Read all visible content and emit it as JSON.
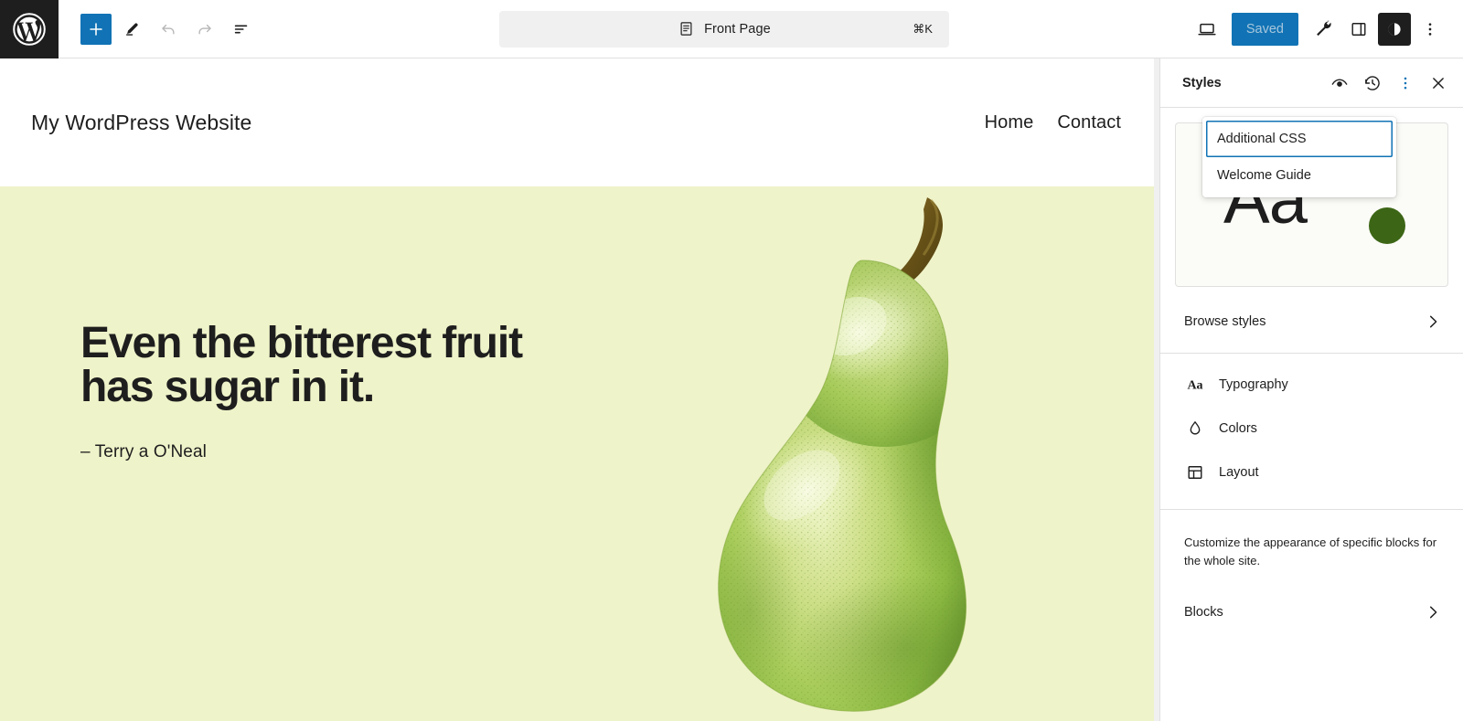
{
  "toolbar": {
    "logo_icon": "wordpress-logo-icon",
    "left_buttons": [
      {
        "name": "add-block-button",
        "label": "Add block",
        "icon": "plus-icon",
        "state": "primary"
      },
      {
        "name": "edit-mode-button",
        "label": "Edit",
        "icon": "pencil-icon",
        "state": "normal"
      },
      {
        "name": "undo-button",
        "label": "Undo",
        "icon": "undo-arrow-icon",
        "state": "disabled"
      },
      {
        "name": "redo-button",
        "label": "Redo",
        "icon": "redo-arrow-icon",
        "state": "disabled"
      },
      {
        "name": "document-overview-button",
        "label": "Document Overview",
        "icon": "list-view-icon",
        "state": "normal"
      }
    ],
    "document_bar": {
      "icon": "page-document-icon",
      "title": "Front Page",
      "shortcut": "⌘K"
    },
    "right_buttons": [
      {
        "name": "view-device-button",
        "label": "View",
        "icon": "laptop-icon"
      },
      {
        "name": "settings-tools-button",
        "label": "Tools",
        "icon": "wrench-icon"
      },
      {
        "name": "toggle-settings-sidebar-button",
        "label": "Settings",
        "icon": "sidebar-panel-icon"
      },
      {
        "name": "styles-button",
        "label": "Styles",
        "icon": "contrast-circle-icon"
      },
      {
        "name": "options-menu-button",
        "label": "Options",
        "icon": "three-dots-vertical-icon"
      }
    ],
    "save_label": "Saved"
  },
  "canvas": {
    "site_title": "My WordPress Website",
    "nav": [
      {
        "label": "Home"
      },
      {
        "label": "Contact"
      }
    ],
    "hero": {
      "heading_line1": "Even the bitterest fruit",
      "heading_line2": "has sugar in it.",
      "citation": "– Terry a O'Neal",
      "background_color": "#eff3c9",
      "image_alt": "green-pear-illustration"
    }
  },
  "sidebar": {
    "title": "Styles",
    "header_buttons": [
      {
        "name": "style-book-button",
        "label": "Style Book",
        "icon": "eye-icon",
        "active": false
      },
      {
        "name": "revisions-button",
        "label": "Revisions",
        "icon": "clock-revision-icon",
        "active": false
      },
      {
        "name": "styles-more-menu-button",
        "label": "More",
        "icon": "three-dots-vertical-icon",
        "active": true
      },
      {
        "name": "close-styles-button",
        "label": "Close Styles",
        "icon": "close-x-icon",
        "active": false
      }
    ],
    "preview": {
      "sample_text": "Aa",
      "swatch_color": "#3c6616",
      "background_color": "#fbfbf7"
    },
    "browse_styles": {
      "label": "Browse styles",
      "icon": "chevron-right-icon"
    },
    "items": [
      {
        "label": "Typography",
        "icon": "aa-typography-icon"
      },
      {
        "label": "Colors",
        "icon": "droplet-icon"
      },
      {
        "label": "Layout",
        "icon": "layout-grid-icon"
      }
    ],
    "blocks_description": "Customize the appearance of specific blocks for the whole site.",
    "blocks_row": {
      "label": "Blocks",
      "icon": "chevron-right-icon"
    }
  },
  "popover": {
    "items": [
      {
        "label": "Additional CSS",
        "focused": true
      },
      {
        "label": "Welcome Guide",
        "focused": false
      }
    ]
  },
  "colors": {
    "accent_blue": "#1173b5",
    "dark": "#1e1e1e",
    "canvas_bg": "#eff3c9",
    "swatch_green": "#3c6616"
  }
}
